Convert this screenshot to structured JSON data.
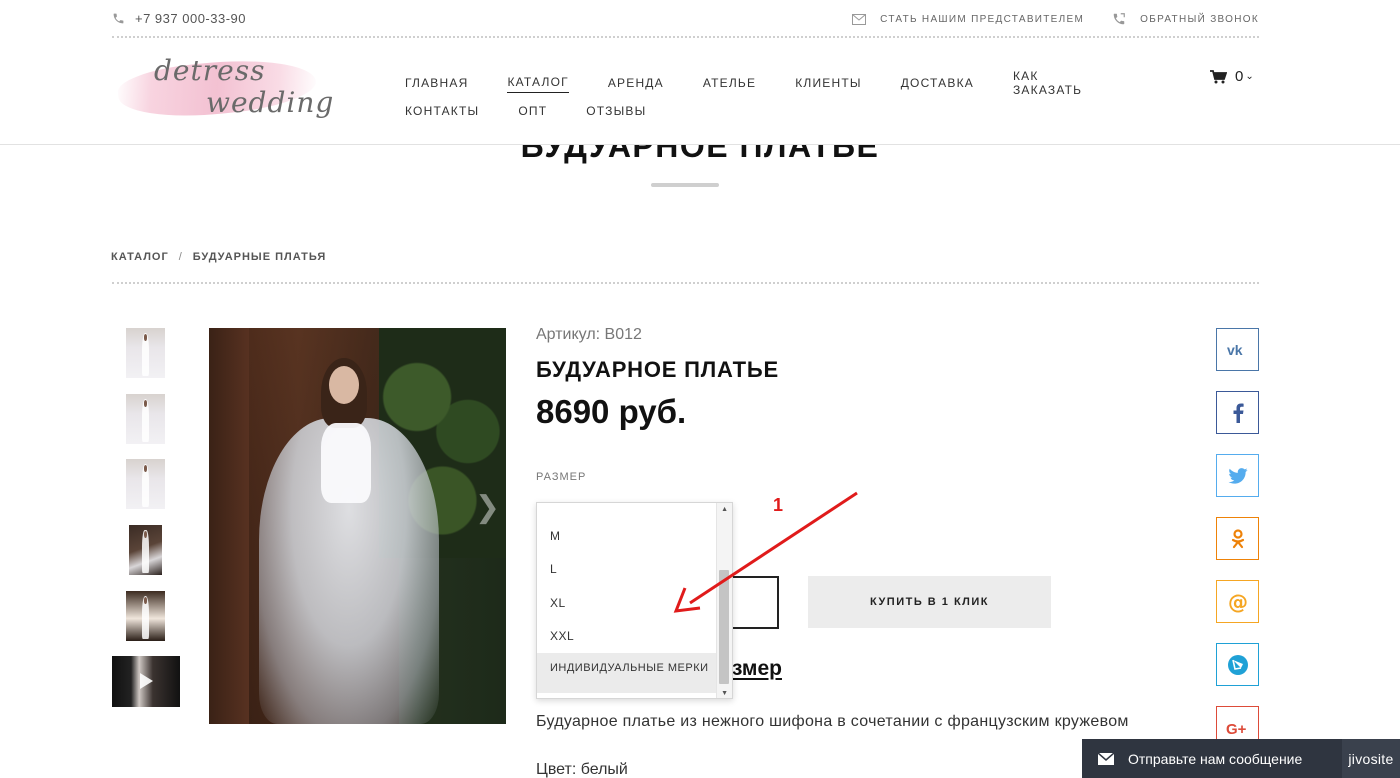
{
  "topbar": {
    "phone": "+7 937 000-33-90",
    "representative": "СТАТЬ НАШИМ ПРЕДСТАВИТЕЛЕМ",
    "callback": "ОБРАТНЫЙ ЗВОНОК"
  },
  "logo": {
    "line1": "detress",
    "line2": "wedding"
  },
  "nav": {
    "row1": [
      "ГЛАВНАЯ",
      "КАТАЛОГ",
      "АРЕНДА",
      "АТЕЛЬЕ",
      "КЛИЕНТЫ",
      "ДОСТАВКА",
      "КАК ЗАКАЗАТЬ"
    ],
    "row2": [
      "КОНТАКТЫ",
      "ОПТ",
      "ОТЗЫВЫ"
    ],
    "active": "КАТАЛОГ"
  },
  "cart": {
    "count": "0"
  },
  "page": {
    "title": "БУДУАРНОЕ ПЛАТЬЕ"
  },
  "breadcrumb": {
    "items": [
      "КАТАЛОГ",
      "БУДУАРНЫЕ ПЛАТЬЯ"
    ],
    "separator": "/"
  },
  "product": {
    "sku": "Артикул: B012",
    "name": "БУДУАРНОЕ ПЛАТЬЕ",
    "price": "8690 руб.",
    "size_label": "РАЗМЕР",
    "size_options": [
      "M",
      "L",
      "XL",
      "XXL",
      "ИНДИВИДУАЛЬНЫЕ МЕРКИ"
    ],
    "selected_option": "ИНДИВИДУАЛЬНЫЕ МЕРКИ",
    "oneclick": "КУПИТЬ В 1 КЛИК",
    "size_link_partial": "змер",
    "description": "Будуарное платье из нежного шифона в сочетании с французским кружевом",
    "color": "Цвет: белый"
  },
  "annotation": {
    "number": "1",
    "color": "#e01b1b"
  },
  "social": [
    {
      "name": "vk",
      "color": "#4a76a8"
    },
    {
      "name": "facebook",
      "color": "#3b5998"
    },
    {
      "name": "twitter",
      "color": "#55acee"
    },
    {
      "name": "odnoklassniki",
      "color": "#ee8208"
    },
    {
      "name": "mailru",
      "color": "#f5a623"
    },
    {
      "name": "livejournal",
      "color": "#1fa1d6"
    },
    {
      "name": "google-plus",
      "color": "#dd4b39"
    }
  ],
  "chat": {
    "message": "Отправьте нам сообщение",
    "brand": "jivosite"
  }
}
